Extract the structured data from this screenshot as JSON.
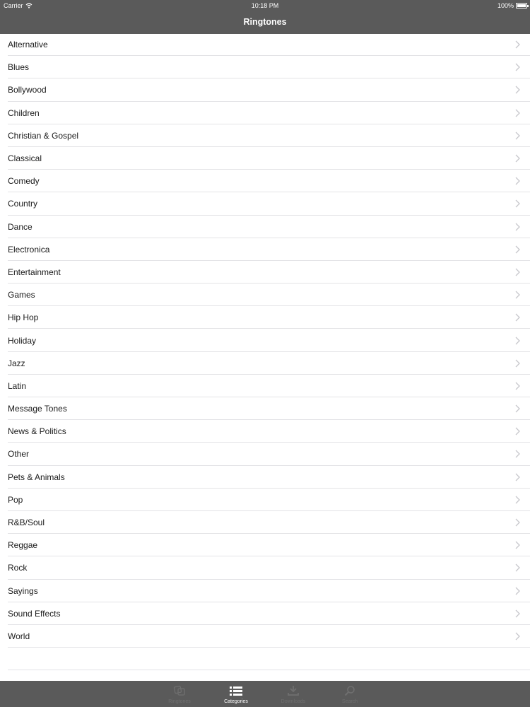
{
  "status_bar": {
    "carrier": "Carrier",
    "time": "10:18 PM",
    "battery": "100%"
  },
  "nav": {
    "title": "Ringtones"
  },
  "categories": [
    "Alternative",
    "Blues",
    "Bollywood",
    "Children",
    "Christian & Gospel",
    "Classical",
    "Comedy",
    "Country",
    "Dance",
    "Electronica",
    "Entertainment",
    "Games",
    "Hip Hop",
    "Holiday",
    "Jazz",
    "Latin",
    "Message Tones",
    "News & Politics",
    "Other",
    "Pets & Animals",
    "Pop",
    "R&B/Soul",
    "Reggae",
    "Rock",
    "Sayings",
    "Sound Effects",
    "World"
  ],
  "tabs": [
    {
      "label": "Ringtones",
      "icon": "ringtones-icon",
      "selected": false
    },
    {
      "label": "Categories",
      "icon": "list-icon",
      "selected": true
    },
    {
      "label": "Downloads",
      "icon": "download-icon",
      "selected": false
    },
    {
      "label": "Search",
      "icon": "search-icon",
      "selected": false
    }
  ],
  "colors": {
    "bar_background": "#5a5a5a",
    "separator": "#e3e3e6",
    "chevron": "#c7c7cc",
    "tab_inactive": "#6f6f6f",
    "tab_active": "#ffffff"
  }
}
